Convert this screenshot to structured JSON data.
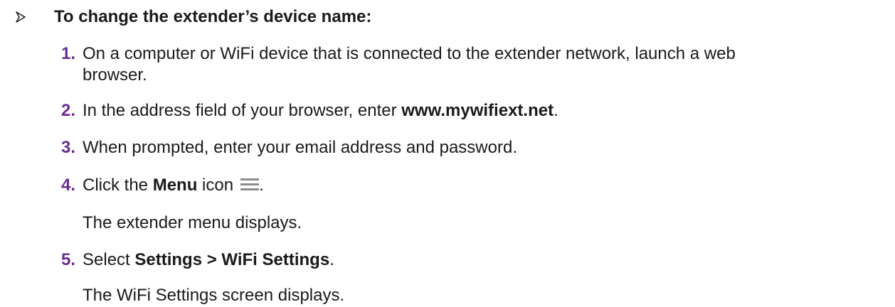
{
  "heading": "To change the extender’s device name:",
  "steps": [
    {
      "num": "1.",
      "line1": "On a computer or WiFi device that is connected to the extender network, launch a web",
      "line2": "browser."
    },
    {
      "num": "2.",
      "pre": "In the address field of your browser, enter ",
      "bold": "www.mywifiext.net",
      "post": "."
    },
    {
      "num": "3.",
      "text": "When prompted, enter your email address and password."
    },
    {
      "num": "4.",
      "pre": "Click the ",
      "bold": "Menu",
      "post": " icon",
      "end": ".",
      "icon": "hamburger-menu-icon",
      "note": "The extender menu displays."
    },
    {
      "num": "5.",
      "pre": "Select ",
      "bold": "Settings > WiFi Settings",
      "post": ".",
      "note": "The WiFi Settings screen displays."
    }
  ],
  "colors": {
    "step_number": "#6c2c91",
    "text": "#1a1a1a",
    "icon": "#8c8c8c"
  }
}
